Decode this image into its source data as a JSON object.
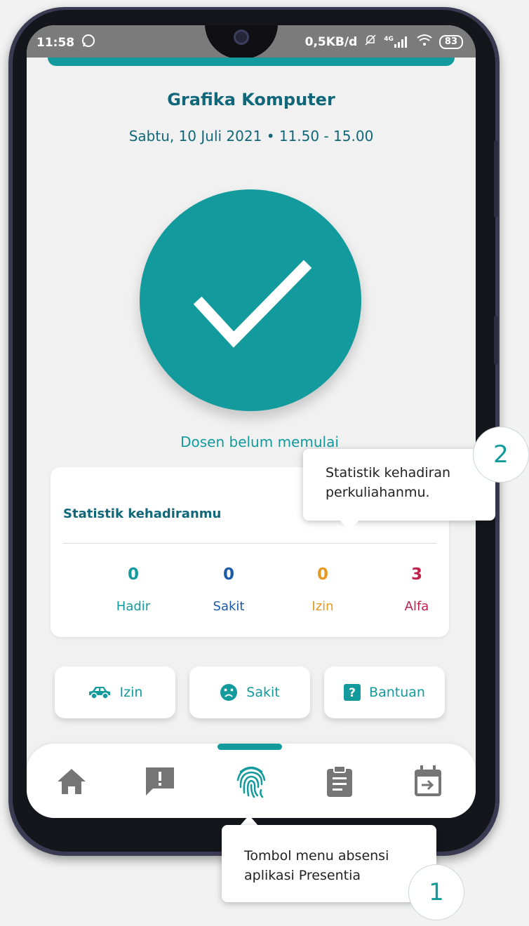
{
  "status_bar": {
    "time": "11:58",
    "network_speed": "0,5KB/d",
    "network_type": "4G",
    "battery": "83",
    "icons": [
      "whatsapp-icon",
      "mute-bell-icon",
      "signal-icon",
      "wifi-icon",
      "battery-icon"
    ]
  },
  "course": {
    "title": "Grafika Komputer",
    "datetime": "Sabtu, 10 Juli 2021 • 11.50 - 15.00"
  },
  "attendance_status_icon": "check-icon",
  "status_message": "Dosen belum memulai",
  "stats": {
    "title": "Statistik kehadiranmu",
    "items": [
      {
        "value": "0",
        "label": "Hadir",
        "color": "#139a9c"
      },
      {
        "value": "0",
        "label": "Sakit",
        "color": "#1a5aa6"
      },
      {
        "value": "0",
        "label": "Izin",
        "color": "#e59a1f"
      },
      {
        "value": "3",
        "label": "Alfa",
        "color": "#c0214a"
      }
    ]
  },
  "actions": [
    {
      "label": "Izin",
      "icon": "car-icon"
    },
    {
      "label": "Sakit",
      "icon": "sad-face-icon"
    },
    {
      "label": "Bantuan",
      "icon": "help-icon"
    }
  ],
  "bottom_nav": {
    "items": [
      "home-icon",
      "report-icon",
      "fingerprint-icon",
      "clipboard-icon",
      "calendar-icon"
    ],
    "active_index": 2
  },
  "tooltips": {
    "stats_tip": {
      "line1": "Statistik kehadiran",
      "line2": "perkuliahanmu.",
      "step": "2"
    },
    "menu_tip": {
      "line1": "Tombol menu absensi",
      "line2": "aplikasi Presentia",
      "step": "1"
    }
  },
  "colors": {
    "accent": "#139a9c",
    "title": "#11677a",
    "nav_icon": "#757575"
  }
}
